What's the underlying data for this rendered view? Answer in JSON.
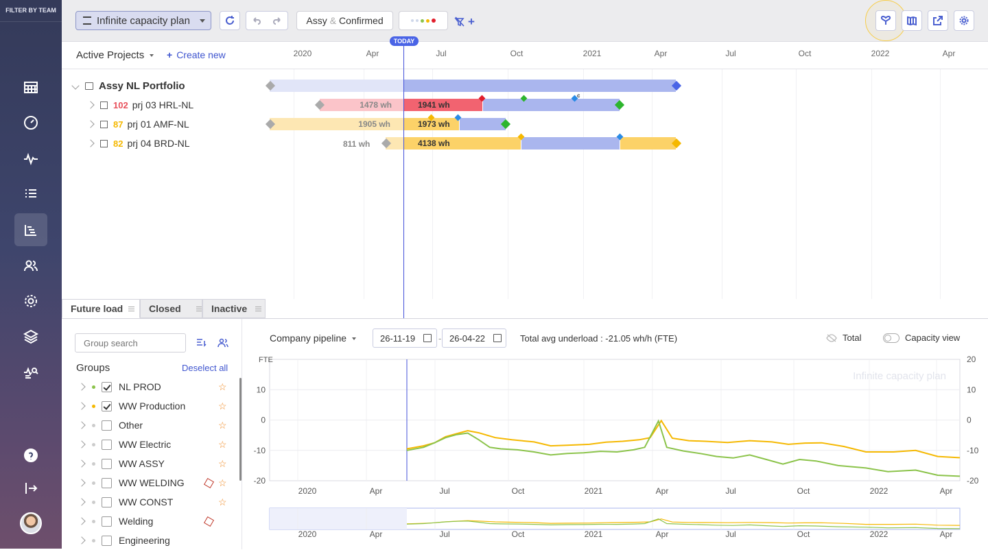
{
  "sidebar": {
    "title": "FILTER BY TEAM",
    "items": [
      {
        "icon": "calendar-grid-icon",
        "active": false
      },
      {
        "icon": "dashboard-gauge-icon",
        "active": false
      },
      {
        "icon": "activity-pulse-icon",
        "active": false
      },
      {
        "icon": "list-icon",
        "active": false
      },
      {
        "icon": "gantt-icon",
        "active": true
      },
      {
        "icon": "users-icon",
        "active": false
      },
      {
        "icon": "gear-icon",
        "active": false
      },
      {
        "icon": "layers-icon",
        "active": false
      },
      {
        "icon": "analytics-search-icon",
        "active": false
      },
      {
        "icon": "help-icon",
        "active": false
      },
      {
        "icon": "logout-icon",
        "active": false
      }
    ]
  },
  "toolbar": {
    "plan_name": "Infinite capacity plan",
    "filter_a": "Assy",
    "filter_amp": "&",
    "filter_b": "Confirmed"
  },
  "gantt": {
    "header": {
      "title": "Active Projects",
      "create": "Create new",
      "months": [
        "2020",
        "Apr",
        "Jul",
        "Oct",
        "2021",
        "Apr",
        "Jul",
        "Oct",
        "2022",
        "Apr"
      ],
      "today": "TODAY"
    },
    "portfolio": {
      "name": "Assy NL Portfolio"
    },
    "projects": [
      {
        "score": "102",
        "score_color": "#e8505b",
        "name": "prj 03 HRL-NL",
        "past_wh": "1478 wh",
        "future_wh": "1941 wh"
      },
      {
        "score": "87",
        "score_color": "#f5b800",
        "name": "prj 01 AMF-NL",
        "past_wh": "1905 wh",
        "future_wh": "1973 wh"
      },
      {
        "score": "82",
        "score_color": "#f5b800",
        "name": "prj 04 BRD-NL",
        "past_wh": "811 wh",
        "future_wh": "4138 wh"
      }
    ],
    "milestone_c": "c"
  },
  "tabs": [
    {
      "label": "Future load",
      "active": true
    },
    {
      "label": "Closed",
      "active": false
    },
    {
      "label": "Inactive",
      "active": false
    }
  ],
  "groups": {
    "search_placeholder": "Group search",
    "title": "Groups",
    "deselect": "Deselect all",
    "items": [
      {
        "name": "NL PROD",
        "checked": true,
        "dot": "#8bc34a",
        "star": true,
        "cube": false
      },
      {
        "name": "WW Production",
        "checked": true,
        "dot": "#f5b800",
        "star": true,
        "cube": false
      },
      {
        "name": "Other",
        "checked": false,
        "dot": "#cccccc",
        "star": true,
        "cube": false
      },
      {
        "name": "WW Electric",
        "checked": false,
        "dot": "#cccccc",
        "star": true,
        "cube": false
      },
      {
        "name": "WW ASSY",
        "checked": false,
        "dot": "#cccccc",
        "star": true,
        "cube": false
      },
      {
        "name": "WW WELDING",
        "checked": false,
        "dot": "#cccccc",
        "star": true,
        "cube": true
      },
      {
        "name": "WW CONST",
        "checked": false,
        "dot": "#cccccc",
        "star": true,
        "cube": false
      },
      {
        "name": "Welding",
        "checked": false,
        "dot": "#cccccc",
        "star": false,
        "cube": true
      },
      {
        "name": "Engineering",
        "checked": false,
        "dot": "#cccccc",
        "star": false,
        "cube": false
      }
    ]
  },
  "chart_controls": {
    "pipeline": "Company pipeline",
    "date_from": "26-11-19",
    "date_sep": "-",
    "date_to": "26-04-22",
    "summary": "Total avg underload : -21.05 wh/h (FTE)",
    "total": "Total",
    "capacity_view": "Capacity view"
  },
  "chart_data": {
    "type": "line",
    "watermark": "Infinite capacity plan",
    "ylabel": "FTE",
    "ylim": [
      -20,
      20
    ],
    "yticks_left": [
      "10",
      "0",
      "-10",
      "-20"
    ],
    "yticks_right": [
      "20",
      "10",
      "0",
      "-10",
      "-20"
    ],
    "xticks": [
      "2020",
      "Apr",
      "Jul",
      "Oct",
      "2021",
      "Apr",
      "Jul",
      "Oct",
      "2022",
      "Apr"
    ],
    "series": [
      {
        "color": "#f5b800",
        "points": [
          [
            0.0,
            -9.5
          ],
          [
            0.03,
            -8.5
          ],
          [
            0.05,
            -7.5
          ],
          [
            0.07,
            -5.5
          ],
          [
            0.09,
            -4.5
          ],
          [
            0.11,
            -3.5
          ],
          [
            0.13,
            -4.2
          ],
          [
            0.16,
            -5.8
          ],
          [
            0.19,
            -6.5
          ],
          [
            0.23,
            -7.2
          ],
          [
            0.26,
            -8.5
          ],
          [
            0.29,
            -8.3
          ],
          [
            0.33,
            -8.0
          ],
          [
            0.36,
            -7.3
          ],
          [
            0.39,
            -7.0
          ],
          [
            0.42,
            -6.5
          ],
          [
            0.44,
            -5.8
          ],
          [
            0.46,
            -0.2
          ],
          [
            0.48,
            -6.0
          ],
          [
            0.51,
            -6.8
          ],
          [
            0.54,
            -7.0
          ],
          [
            0.58,
            -7.4
          ],
          [
            0.62,
            -6.8
          ],
          [
            0.66,
            -7.2
          ],
          [
            0.69,
            -8.0
          ],
          [
            0.72,
            -7.6
          ],
          [
            0.75,
            -7.5
          ],
          [
            0.79,
            -8.7
          ],
          [
            0.83,
            -10.5
          ],
          [
            0.88,
            -10.5
          ],
          [
            0.92,
            -10.0
          ],
          [
            0.96,
            -12.0
          ],
          [
            1.0,
            -12.4
          ]
        ]
      },
      {
        "color": "#8bc34a",
        "points": [
          [
            0.0,
            -10.0
          ],
          [
            0.03,
            -9.0
          ],
          [
            0.05,
            -7.5
          ],
          [
            0.07,
            -5.8
          ],
          [
            0.09,
            -4.8
          ],
          [
            0.11,
            -4.3
          ],
          [
            0.13,
            -6.5
          ],
          [
            0.15,
            -9.0
          ],
          [
            0.17,
            -9.5
          ],
          [
            0.2,
            -9.8
          ],
          [
            0.23,
            -10.5
          ],
          [
            0.26,
            -11.5
          ],
          [
            0.29,
            -11.0
          ],
          [
            0.32,
            -10.8
          ],
          [
            0.35,
            -10.3
          ],
          [
            0.38,
            -10.5
          ],
          [
            0.41,
            -9.8
          ],
          [
            0.43,
            -9.0
          ],
          [
            0.455,
            -0.3
          ],
          [
            0.47,
            -9.0
          ],
          [
            0.5,
            -10.2
          ],
          [
            0.53,
            -11.0
          ],
          [
            0.56,
            -12.0
          ],
          [
            0.59,
            -12.5
          ],
          [
            0.62,
            -11.5
          ],
          [
            0.65,
            -13.0
          ],
          [
            0.68,
            -14.5
          ],
          [
            0.71,
            -13.0
          ],
          [
            0.74,
            -13.5
          ],
          [
            0.78,
            -15.0
          ],
          [
            0.83,
            -15.8
          ],
          [
            0.87,
            -17.0
          ],
          [
            0.92,
            -16.5
          ],
          [
            0.96,
            -18.2
          ],
          [
            1.0,
            -18.5
          ]
        ]
      }
    ]
  }
}
